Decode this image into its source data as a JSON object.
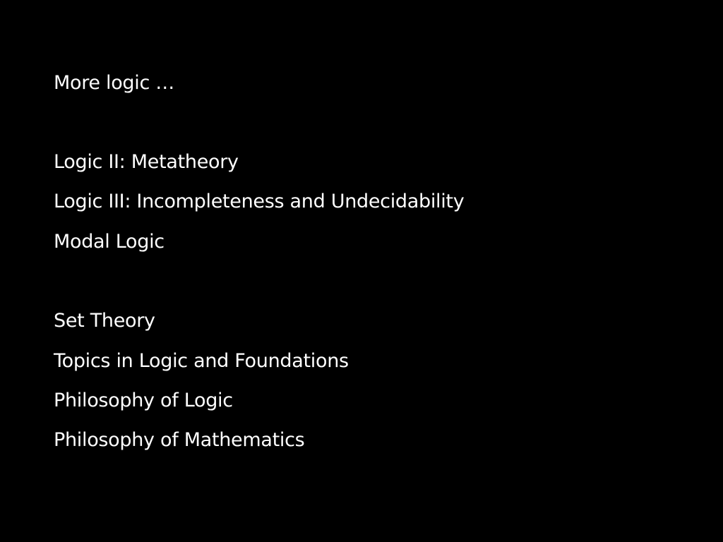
{
  "slide": {
    "title": "More logic …",
    "group_1": [
      "Logic II: Metatheory",
      "Logic III: Incompleteness and Undecidability",
      "Modal Logic"
    ],
    "group_2": [
      "Set Theory",
      "Topics in Logic and Foundations",
      "Philosophy of Logic",
      "Philosophy of Mathematics"
    ]
  },
  "colors": {
    "background": "#000000",
    "text": "#ffffff"
  }
}
